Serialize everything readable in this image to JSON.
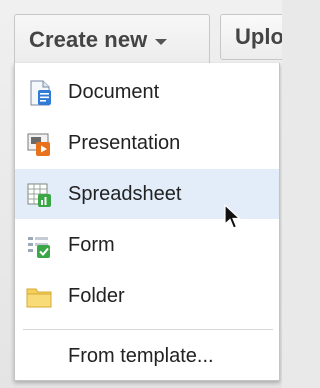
{
  "toolbar": {
    "create_label": "Create new",
    "upload_label": "Uplo"
  },
  "menu": {
    "items": [
      {
        "label": "Document",
        "icon": "document-icon"
      },
      {
        "label": "Presentation",
        "icon": "presentation-icon"
      },
      {
        "label": "Spreadsheet",
        "icon": "spreadsheet-icon",
        "highlighted": true
      },
      {
        "label": "Form",
        "icon": "form-icon"
      },
      {
        "label": "Folder",
        "icon": "folder-icon"
      }
    ],
    "template_label": "From template..."
  },
  "colors": {
    "highlight": "#e3ecf9",
    "document_blue": "#2f7bd6",
    "presentation_orange": "#e8711b",
    "spreadsheet_green": "#3aa746",
    "folder_yellow": "#f5cf5b"
  }
}
